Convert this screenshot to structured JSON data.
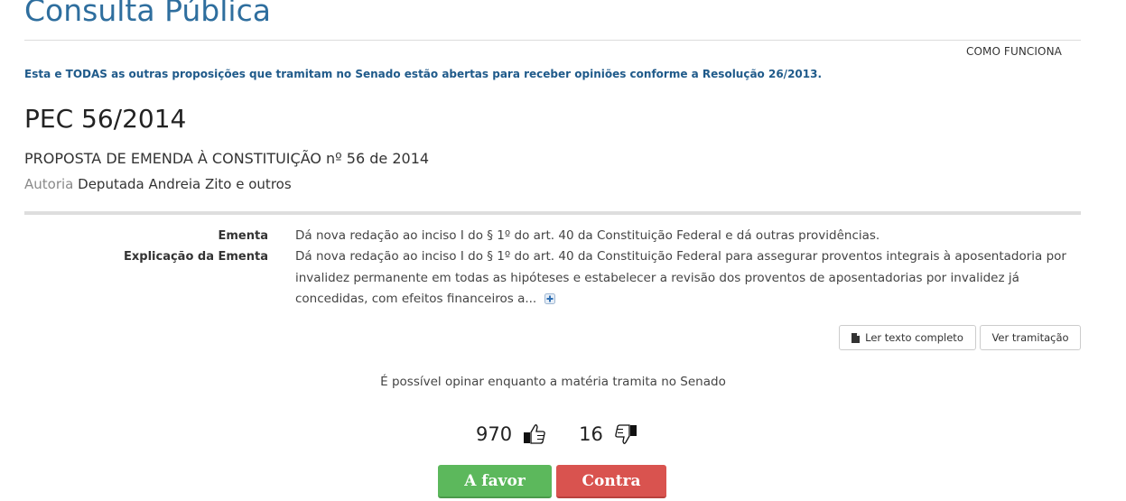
{
  "header": {
    "title": "Consulta Pública",
    "how_it_works": "COMO FUNCIONA",
    "notice": "Esta e TODAS as outras proposições que tramitam no Senado estão abertas para receber opiniões conforme a Resolução 26/2013."
  },
  "proposal": {
    "id": "PEC 56/2014",
    "full_name": "PROPOSTA DE EMENDA À CONSTITUIÇÃO nº 56 de 2014",
    "authorship_label": "Autoria",
    "authorship_value": "Deputada Andreia Zito e outros"
  },
  "details": {
    "ementa_label": "Ementa",
    "ementa_text": "Dá nova redação ao inciso I do § 1º do art. 40 da Constituição Federal e dá outras providências.",
    "explicacao_label": "Explicação da Ementa",
    "explicacao_text": "Dá nova redação ao inciso I do § 1º do art. 40 da Constituição Federal para assegurar proventos integrais à aposentadoria por invalidez permanente em todas as hipóteses e estabelecer a revisão dos proventos de aposentadorias por invalidez já concedidas, com efeitos financeiros a...",
    "expand_icon": "plus-icon"
  },
  "actions": {
    "read_full_text": "Ler texto completo",
    "view_progress": "Ver tramitação"
  },
  "voting": {
    "info": "É possível opinar enquanto a matéria tramita no Senado",
    "votes_for": "970",
    "votes_against": "16",
    "for_label": "A favor",
    "against_label": "Contra",
    "for_color": "#5cb85c",
    "against_color": "#d9534f"
  },
  "colors": {
    "title": "#2e6e9e",
    "notice": "#1f5a8a"
  }
}
